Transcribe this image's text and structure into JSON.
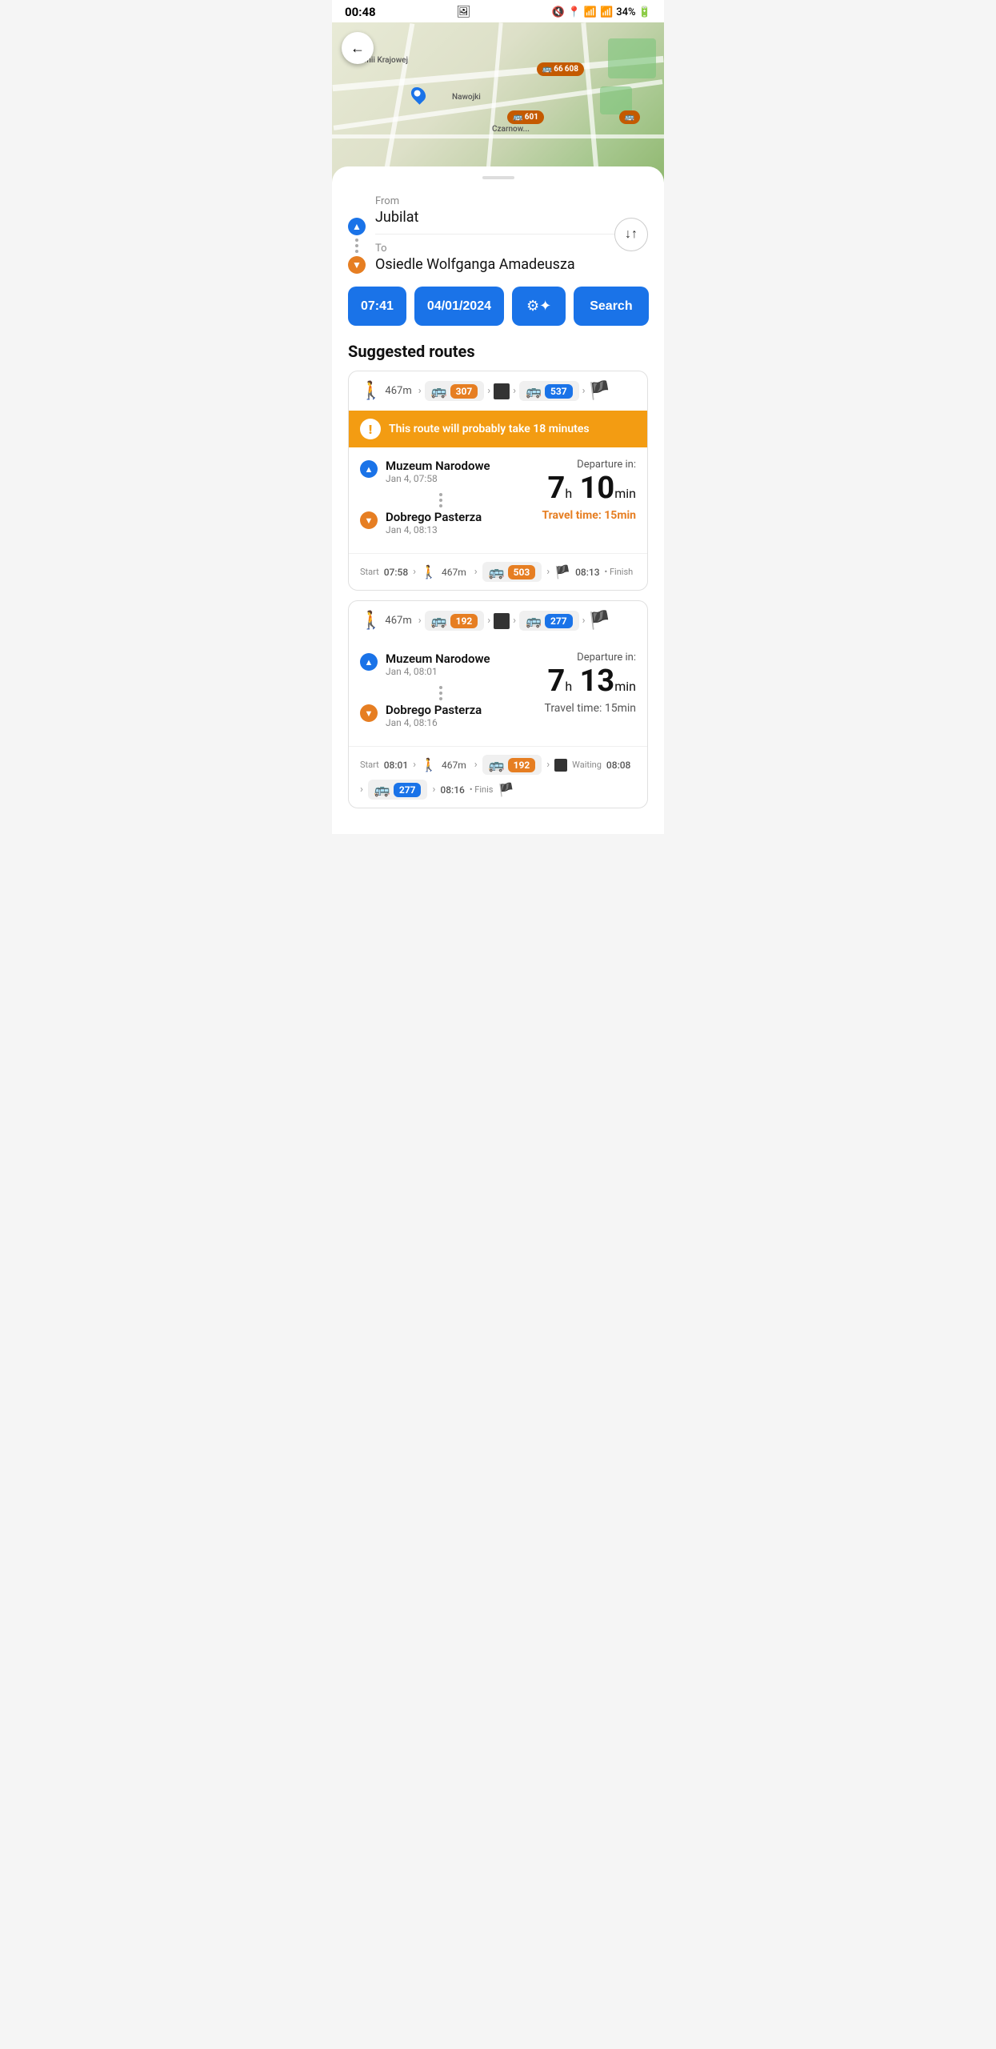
{
  "statusBar": {
    "time": "00:48",
    "icons": "🔇📍📶📶34%🔋"
  },
  "map": {
    "labels": [
      "Armii Krajowej",
      "Nawojki",
      "Czarnow..."
    ]
  },
  "backButton": "←",
  "form": {
    "fromLabel": "From",
    "fromValue": "Jubilat",
    "toLabel": "To",
    "toValue": "Osiedle Wolfganga Amadeusza",
    "swapArrows": "↓↑"
  },
  "actions": {
    "timeLabel": "07:41",
    "dateLabel": "04/01/2024",
    "settingsIcon": "⚙",
    "searchLabel": "Search"
  },
  "suggestedRoutes": {
    "title": "Suggested routes",
    "routes": [
      {
        "id": "route-1",
        "summary": {
          "walkDistance": "467m",
          "bus1Num": "307",
          "bus2Num": "537"
        },
        "warning": "This route will probably take 18 minutes",
        "departure": {
          "fromStop": "Muzeum Narodowe",
          "fromDate": "Jan 4, 07:58",
          "toStop": "Dobrego Pasterza",
          "toDate": "Jan 4, 08:13",
          "departureLabel": "Departure in:",
          "hours": "7",
          "hoursUnit": "h",
          "minutes": "10",
          "minutesUnit": "min",
          "travelTime": "Travel time: 15min",
          "travelTimeColor": "orange"
        },
        "steps": {
          "startLabel": "Start",
          "time1": "07:58",
          "time2": "08:13",
          "finishLabel": "• Finish",
          "busNum": "503",
          "walkDistance": "467m"
        }
      },
      {
        "id": "route-2",
        "summary": {
          "walkDistance": "467m",
          "bus1Num": "192",
          "bus2Num": "277"
        },
        "warning": null,
        "departure": {
          "fromStop": "Muzeum Narodowe",
          "fromDate": "Jan 4, 08:01",
          "toStop": "Dobrego Pasterza",
          "toDate": "Jan 4, 08:16",
          "departureLabel": "Departure in:",
          "hours": "7",
          "hoursUnit": "h",
          "minutes": "13",
          "minutesUnit": "min",
          "travelTime": "Travel time: 15min",
          "travelTimeColor": "gray"
        },
        "steps": {
          "startLabel": "Start",
          "time1": "08:01",
          "waitingLabel": "Waiting",
          "time2": "08:08",
          "time3": "08:16",
          "finishLabel": "• Finis",
          "busNum1": "192",
          "busNum2": "277",
          "walkDistance": "467m"
        }
      }
    ]
  }
}
